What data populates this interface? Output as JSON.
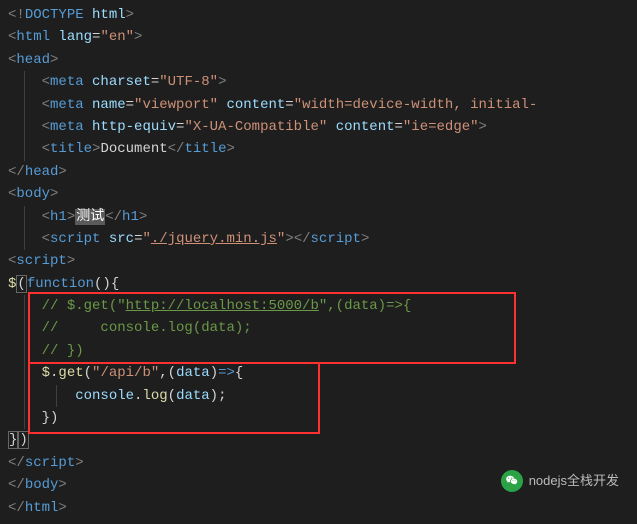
{
  "code": {
    "l1": {
      "doctype_open": "<!",
      "doctype": "DOCTYPE",
      "space": " ",
      "html": "html",
      "close": ">"
    },
    "l2": {
      "open": "<",
      "tag": "html",
      "sp": " ",
      "attr": "lang",
      "eq": "=",
      "val": "\"en\"",
      "close": ">"
    },
    "l3": {
      "open": "<",
      "tag": "head",
      "close": ">"
    },
    "l4": {
      "open": "<",
      "tag": "meta",
      "sp": " ",
      "attr": "charset",
      "eq": "=",
      "val": "\"UTF-8\"",
      "close": ">"
    },
    "l5": {
      "open": "<",
      "tag": "meta",
      "sp": " ",
      "a1": "name",
      "eq": "=",
      "v1": "\"viewport\"",
      "sp2": " ",
      "a2": "content",
      "v2": "\"width=device-width, initial-"
    },
    "l6": {
      "open": "<",
      "tag": "meta",
      "sp": " ",
      "a1": "http-equiv",
      "eq": "=",
      "v1": "\"X-UA-Compatible\"",
      "sp2": " ",
      "a2": "content",
      "v2": "\"ie=edge\"",
      "close": ">"
    },
    "l7": {
      "open": "<",
      "tag": "title",
      "close": ">",
      "text": "Document",
      "open2": "</",
      "close2": ">"
    },
    "l8": {
      "open": "</",
      "tag": "head",
      "close": ">"
    },
    "l9": {
      "open": "<",
      "tag": "body",
      "close": ">"
    },
    "l10": {
      "open": "<",
      "tag": "h1",
      "close": ">",
      "text": "测试",
      "open2": "</",
      "close2": ">"
    },
    "l11": {
      "open": "<",
      "tag": "script",
      "sp": " ",
      "attr": "src",
      "eq": "=",
      "val": "\"",
      "valpath": "./jquery.min.js",
      "valend": "\"",
      "close": ">",
      "open2": "</",
      "close2": ">"
    },
    "l12": {
      "open": "<",
      "tag": "script",
      "close": ">"
    },
    "l13": {
      "dollar": "$",
      "p1": "(",
      "fn": "function",
      "p2": "()",
      "brace": "{"
    },
    "l14": {
      "c": "// $.get(\"",
      "url": "http://localhost:5000/b",
      "c2": "\",(data)=>{"
    },
    "l15": {
      "c": "//     console.log(data);"
    },
    "l16": {
      "c": "// })"
    },
    "l17": {
      "dollar": "$",
      "dot1": ".",
      "get": "get",
      "p1": "(",
      "str": "\"/api/b\"",
      "comma": ",",
      "p2": "(",
      "data": "data",
      "p3": ")",
      "arrow": "=>",
      "brace": "{"
    },
    "l18": {
      "console": "console",
      "dot": ".",
      "log": "log",
      "p1": "(",
      "data": "data",
      "p2": ")",
      "semi": ";"
    },
    "l19": {
      "brace": "}",
      "paren": ")"
    },
    "l20": {
      "brace": "}",
      "paren": ")"
    },
    "l21": {
      "open": "</",
      "tag": "script",
      "close": ">"
    },
    "l22": {
      "open": "</",
      "tag": "body",
      "close": ">"
    },
    "l23": {
      "open": "</",
      "tag": "html",
      "close": ">"
    }
  },
  "watermark": {
    "text": "nodejs全栈开发"
  }
}
